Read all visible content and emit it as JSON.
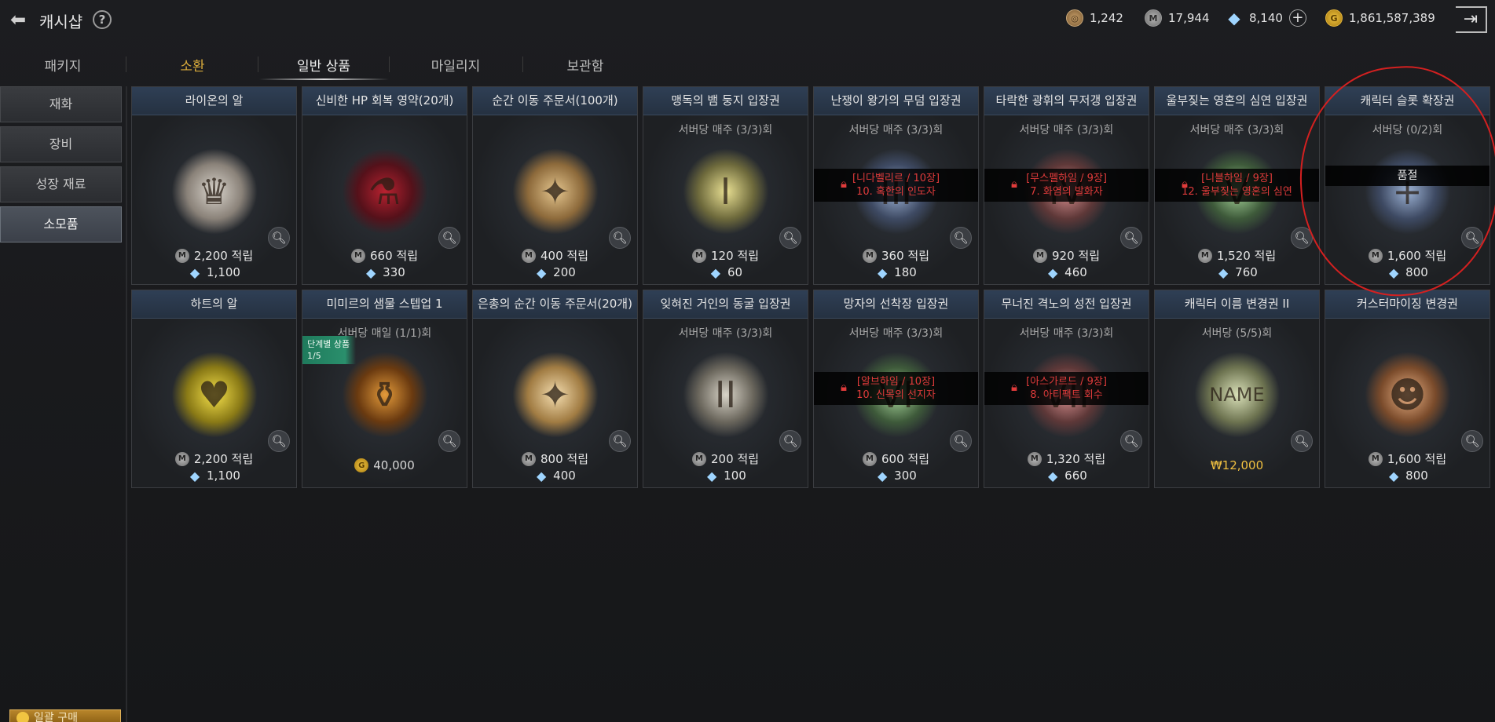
{
  "header": {
    "title": "캐시샵",
    "help_icon": "?",
    "currencies": [
      {
        "icon": "coin-icon",
        "value": "1,242"
      },
      {
        "icon": "m-coin-icon",
        "value": "17,944"
      },
      {
        "icon": "gem-icon",
        "value": "8,140"
      },
      {
        "icon": "gold-icon",
        "value": "1,861,587,389"
      }
    ]
  },
  "tabs": [
    {
      "label": "패키지"
    },
    {
      "label": "소환"
    },
    {
      "label": "일반 상품"
    },
    {
      "label": "마일리지"
    },
    {
      "label": "보관함"
    }
  ],
  "sidebar": {
    "items": [
      {
        "label": "재화"
      },
      {
        "label": "장비"
      },
      {
        "label": "성장 재료"
      },
      {
        "label": "소모품"
      }
    ],
    "bulk_label": "일괄 구매"
  },
  "colors": {
    "accent_gold": "#d8aa3b",
    "lock_red": "#e03b3b",
    "annotation_red": "#d42020"
  },
  "cards": [
    {
      "name": "라이온의 알",
      "limit": "",
      "m_price": "2,200 적립",
      "gem_price": "1,100",
      "lock1": "",
      "lock2": ""
    },
    {
      "name": "신비한 HP 회복 영약(20개)",
      "limit": "",
      "m_price": "660 적립",
      "gem_price": "330",
      "lock1": "",
      "lock2": ""
    },
    {
      "name": "순간 이동 주문서(100개)",
      "limit": "",
      "m_price": "400 적립",
      "gem_price": "200",
      "lock1": "",
      "lock2": ""
    },
    {
      "name": "맹독의 뱀 둥지 입장권",
      "limit": "서버당 매주 (3/3)회",
      "m_price": "120 적립",
      "gem_price": "60",
      "lock1": "",
      "lock2": ""
    },
    {
      "name": "난쟁이 왕가의 무덤 입장권",
      "limit": "서버당 매주 (3/3)회",
      "m_price": "360 적립",
      "gem_price": "180",
      "lock1": "[니다벨리르 / 10장]",
      "lock2": "10. 혹한의 인도자"
    },
    {
      "name": "타락한 광휘의 무저갱 입장권",
      "limit": "서버당 매주 (3/3)회",
      "m_price": "920 적립",
      "gem_price": "460",
      "lock1": "[무스펠하임 / 9장]",
      "lock2": "7. 화염의 발화자"
    },
    {
      "name": "울부짖는 영혼의 심연 입장권",
      "limit": "서버당 매주 (3/3)회",
      "m_price": "1,520 적립",
      "gem_price": "760",
      "lock1": "[니블하임 / 9장]",
      "lock2": "12. 울부짖는 영혼의 심연"
    },
    {
      "name": "캐릭터 슬롯 확장권",
      "limit": "서버당  (0/2)회",
      "m_price": "1,600 적립",
      "gem_price": "800",
      "soldout": "품절"
    },
    {
      "name": "하트의 알",
      "limit": "",
      "m_price": "2,200 적립",
      "gem_price": "1,100",
      "lock1": "",
      "lock2": ""
    },
    {
      "name": "미미르의 샘물 스텝업 1",
      "limit": "서버당 매일 (1/1)회",
      "stage_tag": "단계별 상품",
      "stage_count": "1/5",
      "gold_price": "40,000"
    },
    {
      "name": "은총의 순간 이동 주문서(20개)",
      "limit": "",
      "m_price": "800 적립",
      "gem_price": "400",
      "lock1": "",
      "lock2": ""
    },
    {
      "name": "잊혀진 거인의 동굴 입장권",
      "limit": "서버당 매주 (3/3)회",
      "m_price": "200 적립",
      "gem_price": "100",
      "lock1": "",
      "lock2": ""
    },
    {
      "name": "망자의 선착장 입장권",
      "limit": "서버당 매주 (3/3)회",
      "m_price": "600 적립",
      "gem_price": "300",
      "lock1": "[알브하임 / 10장]",
      "lock2": "10. 신목의 선지자"
    },
    {
      "name": "무너진 격노의 성전 입장권",
      "limit": "서버당 매주 (3/3)회",
      "m_price": "1,320 적립",
      "gem_price": "660",
      "lock1": "[아스가르드 / 9장]",
      "lock2": "8. 아티팩트 회수"
    },
    {
      "name": "캐릭터 이름 변경권 II",
      "limit": "서버당  (5/5)회",
      "krw_price": "₩12,000"
    },
    {
      "name": "커스터마이징 변경권",
      "limit": "",
      "m_price": "1,600 적립",
      "gem_price": "800",
      "lock1": "",
      "lock2": ""
    }
  ]
}
